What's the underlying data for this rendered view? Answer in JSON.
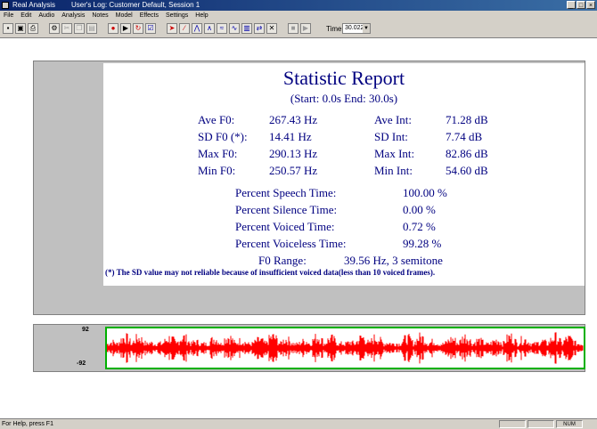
{
  "window": {
    "app_name": "Real Analysis",
    "session": "User's Log: Customer Default, Session 1",
    "controls": [
      "_",
      "□",
      "×"
    ]
  },
  "menu": [
    "File",
    "Edit",
    "Audio",
    "Analysis",
    "Notes",
    "Model",
    "Effects",
    "Settings",
    "Help"
  ],
  "toolbar": {
    "time_label": "Time",
    "time_value": "30.022"
  },
  "report": {
    "title": "Statistic Report",
    "range": "(Start: 0.0s     End: 30.0s)",
    "left_stats": [
      {
        "label": "Ave F0:",
        "value": "267.43 Hz"
      },
      {
        "label": "SD F0 (*):",
        "value": "14.41 Hz"
      },
      {
        "label": "Max F0:",
        "value": "290.13 Hz"
      },
      {
        "label": "Min F0:",
        "value": "250.57 Hz"
      }
    ],
    "right_stats": [
      {
        "label": "Ave Int:",
        "value": "71.28 dB"
      },
      {
        "label": "SD Int:",
        "value": "7.74 dB"
      },
      {
        "label": "Max Int:",
        "value": "82.86 dB"
      },
      {
        "label": "Min Int:",
        "value": "54.60 dB"
      }
    ],
    "percent_stats": [
      {
        "label": "Percent Speech Time:",
        "value": "100.00 %"
      },
      {
        "label": "Percent Silence Time:",
        "value": "0.00 %"
      },
      {
        "label": "Percent Voiced Time:",
        "value": "0.72 %"
      },
      {
        "label": "Percent Voiceless Time:",
        "value": "99.28 %"
      }
    ],
    "f0_range": {
      "label": "F0 Range:",
      "value": "39.56 Hz,  3 semitone"
    },
    "note": "(*) The SD value may not reliable because of insufficient voiced data(less than 10 voiced frames)."
  },
  "waveform": {
    "max_label": "92",
    "min_label": "-92",
    "color": "#ff0000",
    "border_color": "#00b000"
  },
  "status": {
    "help": "For Help, press F1",
    "num": "NUM"
  }
}
